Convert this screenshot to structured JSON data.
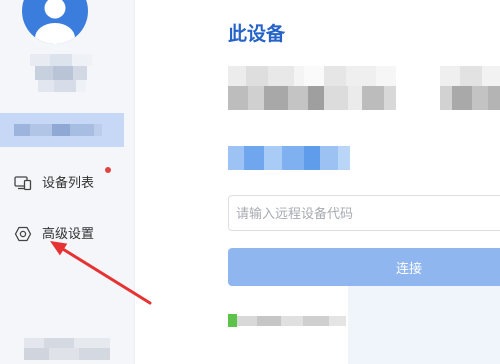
{
  "sidebar": {
    "items": [
      {
        "label": "设备列表",
        "icon": "device-list-icon",
        "has_badge": true
      },
      {
        "label": "高级设置",
        "icon": "settings-icon",
        "has_badge": false
      }
    ]
  },
  "main": {
    "title": "此设备",
    "remote_input": {
      "placeholder": "请输入远程设备代码",
      "value": ""
    },
    "connect_label": "连接"
  },
  "colors": {
    "accent": "#2563c9",
    "connect_button": "#8fb6ef",
    "badge": "#e0443e",
    "annotation_arrow": "#e63232",
    "status_green": "#5cc24a"
  }
}
